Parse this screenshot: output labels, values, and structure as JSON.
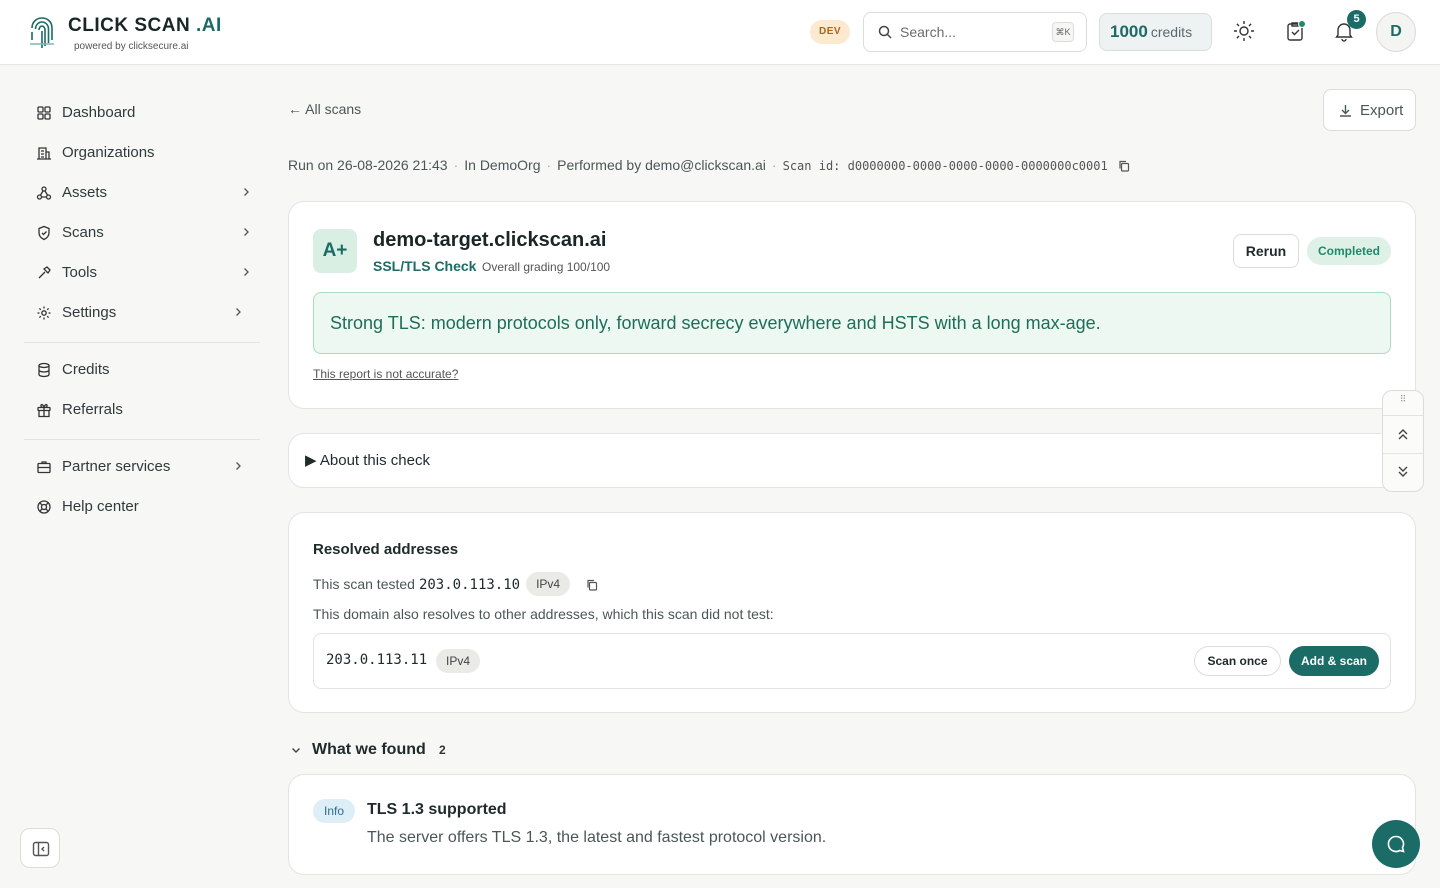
{
  "brand": {
    "name_main": "CLICK SCAN",
    "name_suffix": ".AI",
    "tagline": "powered by clicksecure.ai"
  },
  "header": {
    "env_badge": "DEV",
    "search_placeholder": "Search...",
    "search_shortcut": "⌘K",
    "credits_value": "1000",
    "credits_label": "credits",
    "notifications_count": "5",
    "avatar_initial": "D"
  },
  "sidebar": {
    "items": [
      {
        "label": "Dashboard",
        "icon": "grid-icon",
        "has_submenu": false
      },
      {
        "label": "Organizations",
        "icon": "building-icon",
        "has_submenu": false
      },
      {
        "label": "Assets",
        "icon": "network-icon",
        "has_submenu": true
      },
      {
        "label": "Scans",
        "icon": "shield-icon",
        "has_submenu": true
      },
      {
        "label": "Tools",
        "icon": "hammer-icon",
        "has_submenu": true
      },
      {
        "label": "Settings",
        "icon": "gear-icon",
        "has_submenu": true
      },
      {
        "label": "Credits",
        "icon": "database-icon",
        "has_submenu": false
      },
      {
        "label": "Referrals",
        "icon": "gift-icon",
        "has_submenu": false
      },
      {
        "label": "Partner services",
        "icon": "briefcase-icon",
        "has_submenu": true
      },
      {
        "label": "Help center",
        "icon": "lifebuoy-icon",
        "has_submenu": false
      }
    ]
  },
  "page": {
    "back_label": "All scans",
    "export_label": "Export",
    "run_on": "Run on 26-08-2026 21:43",
    "org": "In DemoOrg",
    "performed_by": "Performed by demo@clickscan.ai",
    "scan_id": "Scan id: d0000000-0000-0000-0000-0000000c0001"
  },
  "result": {
    "grade": "A+",
    "target": "demo-target.clickscan.ai",
    "check_name": "SSL/TLS Check",
    "grading": "Overall grading 100/100",
    "rerun_label": "Rerun",
    "status": "Completed",
    "summary": "Strong TLS: modern protocols only, forward secrecy everywhere and HSTS with a long max-age.",
    "inaccurate_link": "This report is not accurate?"
  },
  "about": {
    "label": "About this check"
  },
  "resolved": {
    "title": "Resolved addresses",
    "tested_prefix": "This scan tested",
    "tested_ip": "203.0.113.10",
    "tested_type": "IPv4",
    "also_text": "This domain also resolves to other addresses, which this scan did not test:",
    "other": [
      {
        "ip": "203.0.113.11",
        "type": "IPv4",
        "scan_once_label": "Scan once",
        "add_scan_label": "Add & scan"
      }
    ]
  },
  "findings": {
    "title": "What we found",
    "count": "2",
    "items": [
      {
        "severity": "Info",
        "title": "TLS 1.3 supported",
        "description": "The server offers TLS 1.3, the latest and fastest protocol version."
      }
    ]
  },
  "colors": {
    "accent": "#1b6b66",
    "success_bg": "#ecf8f1",
    "success_text": "#1f6e5a",
    "dev_badge_bg": "#fbe9d0"
  }
}
